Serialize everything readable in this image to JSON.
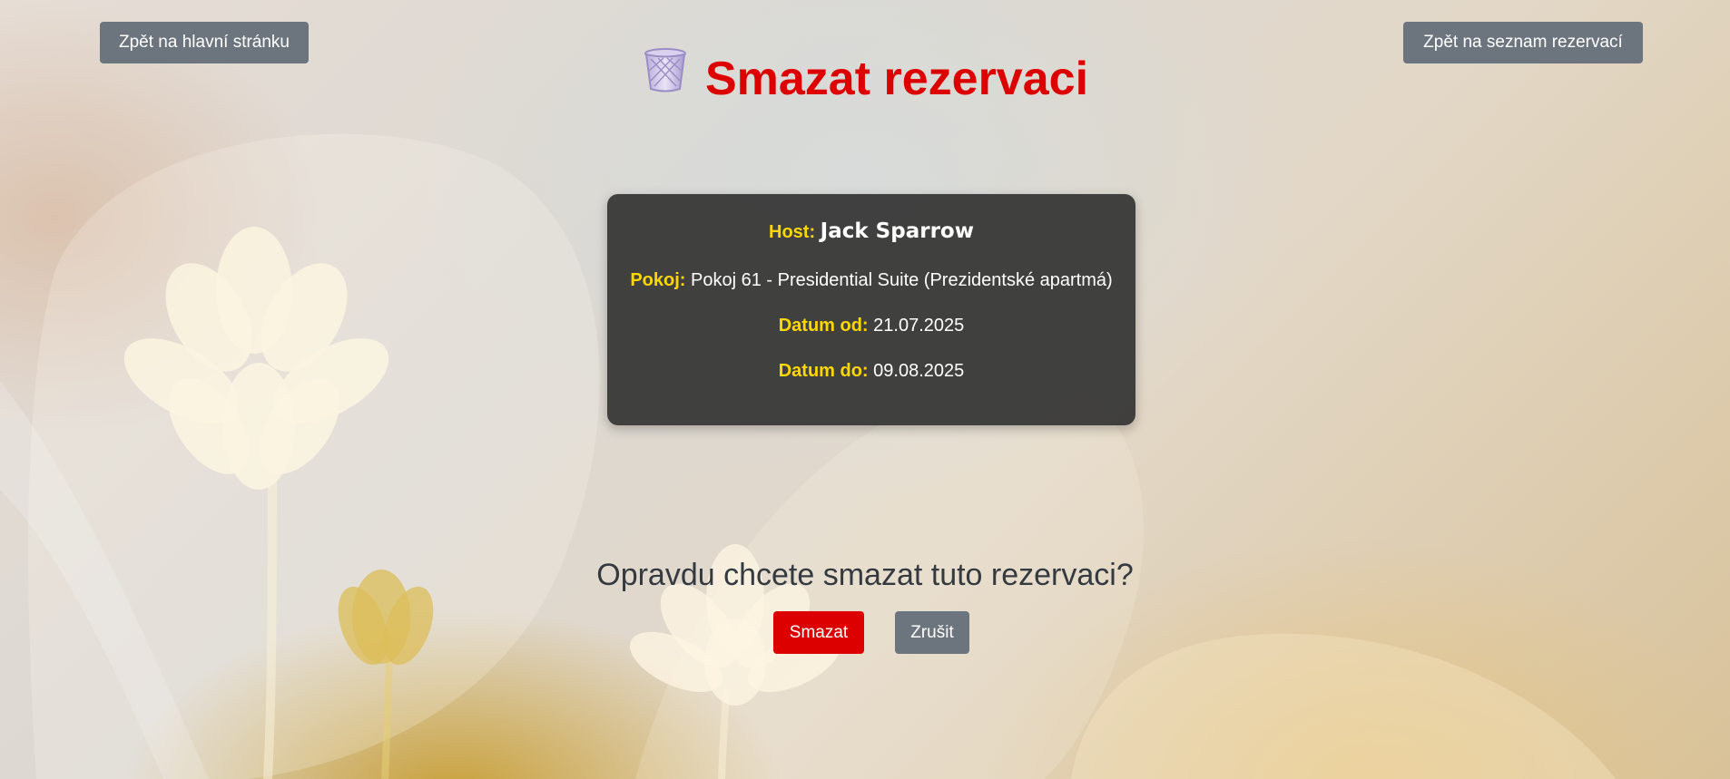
{
  "nav": {
    "home_label": "Zpět na hlavní stránku",
    "list_label": "Zpět na seznam rezervací"
  },
  "header": {
    "title": "Smazat rezervaci",
    "icon": "wastebasket-icon"
  },
  "reservation": {
    "host_label": "Host:",
    "host_value": "Jack Sparrow",
    "room_label": "Pokoj:",
    "room_value": "Pokoj 61 - Presidential Suite (Prezidentské apartmá)",
    "date_from_label": "Datum od:",
    "date_from_value": "21.07.2025",
    "date_to_label": "Datum do:",
    "date_to_value": "09.08.2025"
  },
  "confirm": {
    "question": "Opravdu chcete smazat tuto rezervaci?",
    "delete_label": "Smazat",
    "cancel_label": "Zrušit"
  },
  "colors": {
    "title": "#dd0000",
    "label": "#ffd700",
    "delete_button": "#dd0000",
    "secondary_button": "#6c757d",
    "card_background": "#343434"
  }
}
